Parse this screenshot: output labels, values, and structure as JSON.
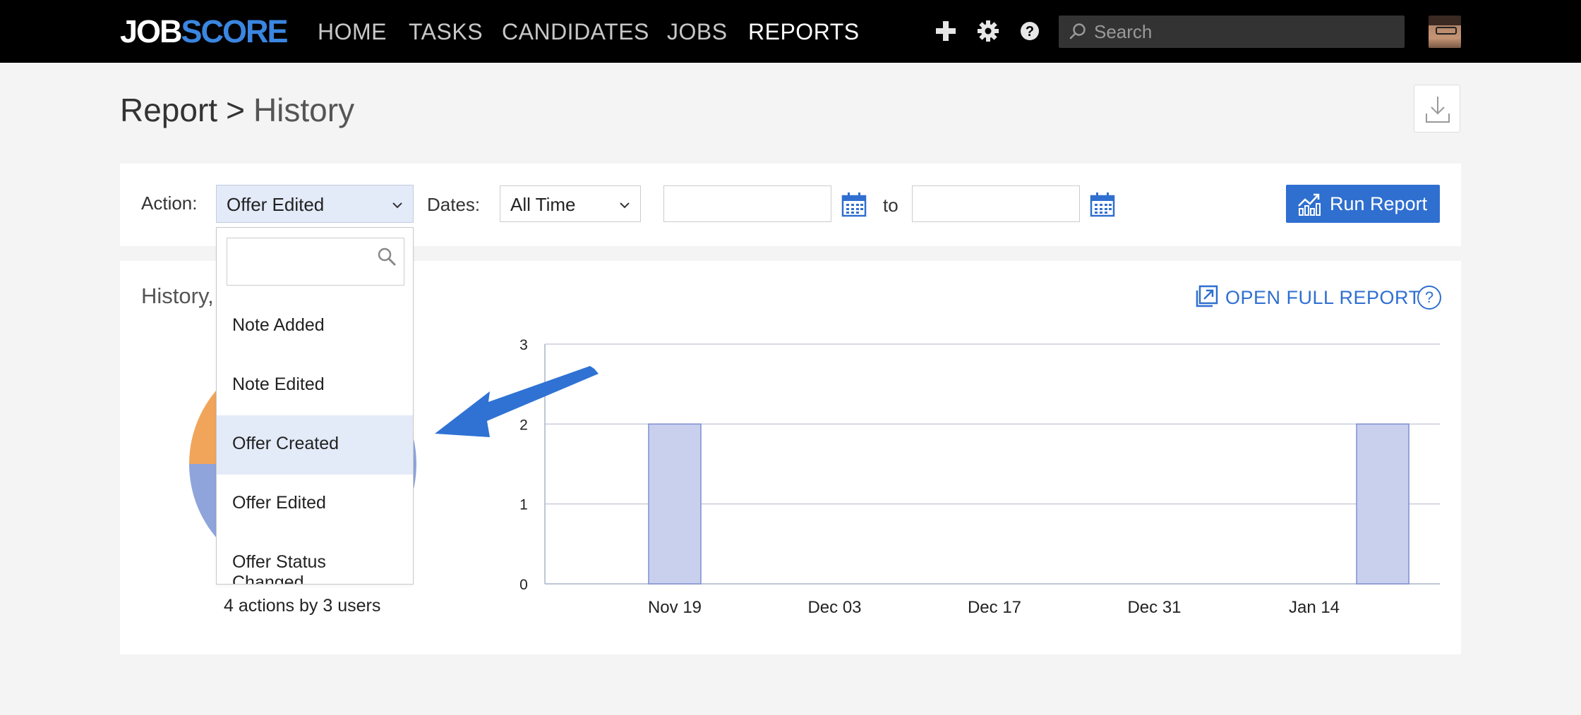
{
  "nav": {
    "logo_part1": "JOB",
    "logo_part2": "SCORE",
    "items": [
      {
        "label": "HOME"
      },
      {
        "label": "TASKS"
      },
      {
        "label": "CANDIDATES"
      },
      {
        "label": "JOBS"
      },
      {
        "label": "REPORTS",
        "active": true
      }
    ],
    "search_placeholder": "Search",
    "icons": [
      "plus-icon",
      "gear-icon",
      "help-icon",
      "search-icon",
      "avatar"
    ]
  },
  "breadcrumb": {
    "root": "Report",
    "separator": ">",
    "current": "History"
  },
  "filters": {
    "action_label": "Action:",
    "action_value": "Offer Edited",
    "dates_label": "Dates:",
    "dates_value": "All Time",
    "from_date": "",
    "to_label": "to",
    "to_date": "",
    "run_label": "Run Report"
  },
  "dropdown": {
    "search_value": "",
    "options": [
      "Note Added",
      "Note Edited",
      "Offer Created",
      "Offer Edited",
      "Offer Status Changed"
    ],
    "highlighted": "Offer Created"
  },
  "panel": {
    "title": "History,",
    "open_full_label": "OPEN FULL REPORT",
    "help_glyph": "?",
    "summary": "4 actions by 3 users"
  },
  "colors": {
    "accent": "#2f6fd0",
    "bar_fill": "#c9d0ee",
    "bar_stroke": "#7f8fd1",
    "pie_orange": "#f0a55a",
    "pie_blue": "#8fa4db"
  },
  "chart_data": [
    {
      "type": "bar",
      "x_tick_labels": [
        "Nov 19",
        "Dec 03",
        "Dec 17",
        "Dec 31",
        "Jan 14"
      ],
      "bars": [
        {
          "x": "Nov 19",
          "value": 2
        },
        {
          "x": "Jan 20",
          "value": 2
        }
      ],
      "y_ticks": [
        0,
        1,
        2,
        3
      ],
      "ylim": [
        0,
        3
      ],
      "grid": true
    },
    {
      "type": "pie",
      "slices": [
        {
          "color": "#f0a55a"
        },
        {
          "color": "#8fa4db"
        }
      ]
    }
  ]
}
